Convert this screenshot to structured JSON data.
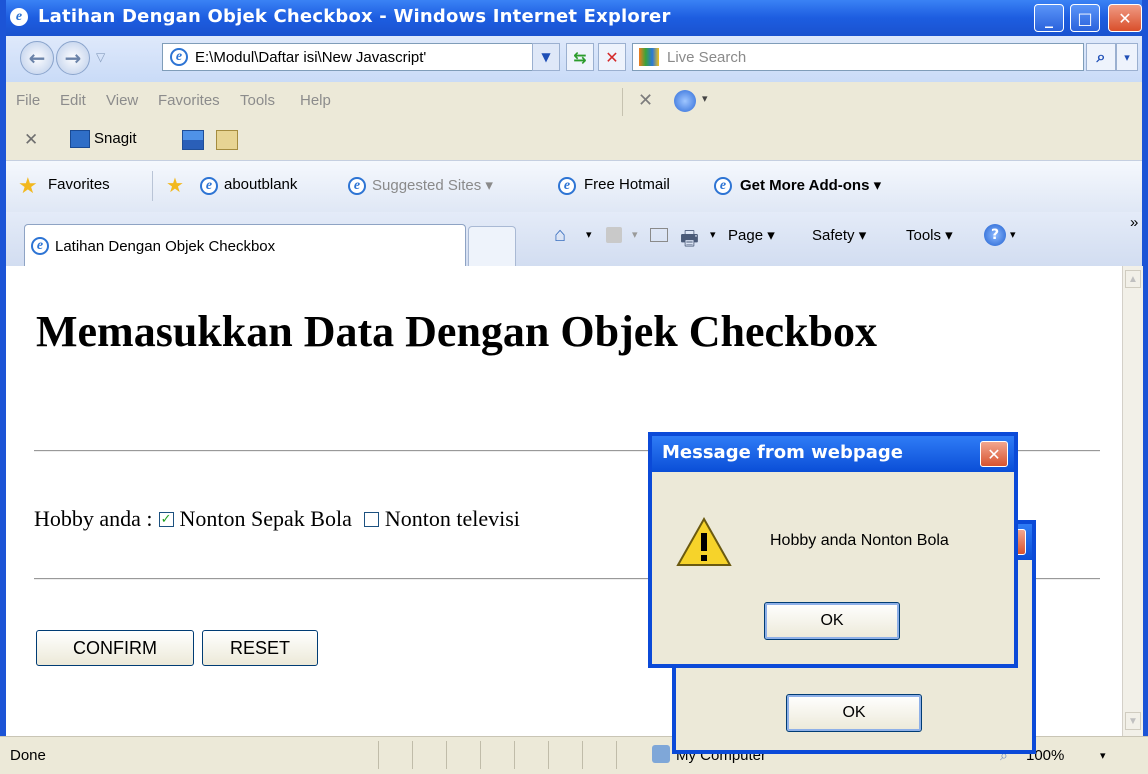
{
  "window": {
    "title": "Latihan Dengan Objek Checkbox - Windows Internet Explorer"
  },
  "nav": {
    "address": "E:\\Modul\\Daftar isi\\New Javascript'",
    "search_placeholder": "Live Search"
  },
  "menu": {
    "items": [
      "File",
      "Edit",
      "View",
      "Favorites",
      "Tools",
      "Help"
    ]
  },
  "toolbar": {
    "snagit_label": "Snagit"
  },
  "favorites": {
    "label": "Favorites",
    "items": [
      "aboutblank",
      "Suggested Sites ▾",
      "Free Hotmail",
      "Get More Add-ons ▾"
    ]
  },
  "tabs": {
    "active_title": "Latihan Dengan Objek Checkbox"
  },
  "commands": {
    "page": "Page ▾",
    "safety": "Safety ▾",
    "tools": "Tools ▾",
    "more": "»"
  },
  "page": {
    "title": "Memasukkan Data Dengan Objek Checkbox",
    "hobby_label": "Hobby anda :",
    "options": [
      {
        "label": "Nonton Sepak Bola",
        "checked": true
      },
      {
        "label": "Nonton televisi",
        "checked": false
      }
    ],
    "confirm_label": "CONFIRM",
    "reset_label": "RESET"
  },
  "status": {
    "text": "Done",
    "zone": "My Computer",
    "zoom": "100%"
  },
  "dialog": {
    "title": "Message from webpage",
    "message": "Hobby anda Nonton Bola",
    "ok_label": "OK",
    "back_ok_label": "OK"
  }
}
